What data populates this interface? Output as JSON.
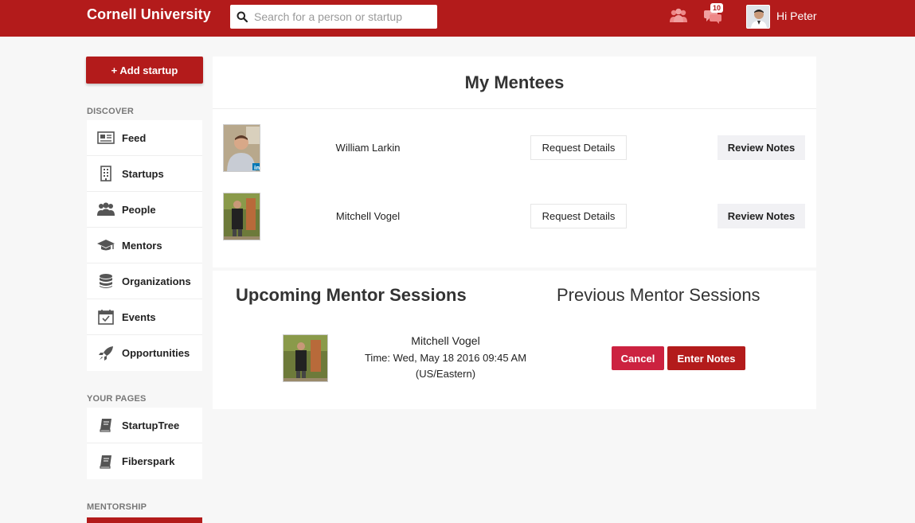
{
  "header": {
    "brand": "Cornell University",
    "search_placeholder": "Search for a person or startup",
    "message_count": "10",
    "greeting": "Hi Peter",
    "icons": {
      "search": "search-icon",
      "people": "people-icon",
      "messages": "chat-bubbles-icon"
    },
    "brand_color": "#b31b1b"
  },
  "sidebar": {
    "add_startup_label": "+ Add startup",
    "discover_title": "DISCOVER",
    "discover_items": [
      {
        "label": "Feed",
        "icon": "newspaper-icon"
      },
      {
        "label": "Startups",
        "icon": "building-icon"
      },
      {
        "label": "People",
        "icon": "people-icon"
      },
      {
        "label": "Mentors",
        "icon": "graduation-cap-icon"
      },
      {
        "label": "Organizations",
        "icon": "database-icon"
      },
      {
        "label": "Events",
        "icon": "calendar-check-icon"
      },
      {
        "label": "Opportunities",
        "icon": "rocket-icon"
      }
    ],
    "your_pages_title": "YOUR PAGES",
    "your_pages_items": [
      {
        "label": "StartupTree",
        "icon": "book-icon"
      },
      {
        "label": "Fiberspark",
        "icon": "book-icon"
      }
    ],
    "mentorship_title": "MENTORSHIP"
  },
  "mentees": {
    "title": "My Mentees",
    "rows": [
      {
        "name": "William Larkin",
        "request_label": "Request Details",
        "review_label": "Review Notes"
      },
      {
        "name": "Mitchell Vogel",
        "request_label": "Request Details",
        "review_label": "Review Notes"
      }
    ]
  },
  "sessions": {
    "tab_upcoming": "Upcoming Mentor Sessions",
    "tab_previous": "Previous Mentor Sessions",
    "items": [
      {
        "name": "Mitchell Vogel",
        "time": "Time: Wed, May 18 2016 09:45 AM",
        "timezone": "(US/Eastern)",
        "cancel_label": "Cancel",
        "enter_notes_label": "Enter Notes"
      }
    ]
  }
}
